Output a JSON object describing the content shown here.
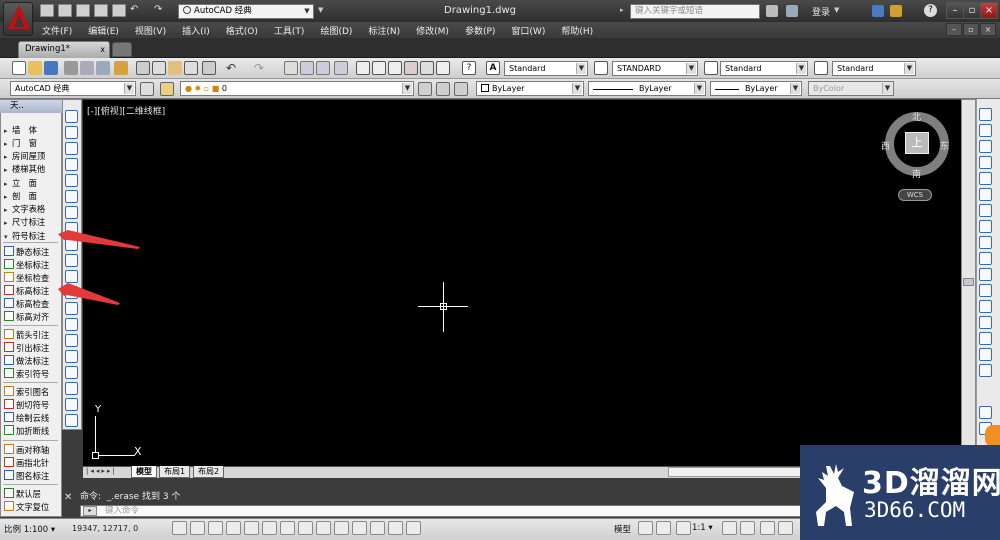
{
  "titlebar": {
    "workspace": "AutoCAD 经典",
    "document": "Drawing1.dwg",
    "search_placeholder": "键入关键字或短语",
    "login": "登录",
    "help": "?"
  },
  "menu": [
    "文件(F)",
    "编辑(E)",
    "视图(V)",
    "插入(I)",
    "格式(O)",
    "工具(T)",
    "绘图(D)",
    "标注(N)",
    "修改(M)",
    "参数(P)",
    "窗口(W)",
    "帮助(H)"
  ],
  "doc_tab": {
    "label": "Drawing1*",
    "close": "x"
  },
  "toolbar1": {
    "text_style": "Standard",
    "dim_style": "STANDARD",
    "table_style": "Standard",
    "mleader_style": "Standard"
  },
  "toolbar2": {
    "workspace": "AutoCAD 经典",
    "layer": "0",
    "color": "ByLayer",
    "linetype": "ByLayer",
    "lineweight": "ByLayer",
    "plotstyle": "ByColor"
  },
  "palette": {
    "title": "天..",
    "items": [
      {
        "label": "墙　体",
        "arrow": "▸"
      },
      {
        "label": "门　窗",
        "arrow": "▸"
      },
      {
        "label": "房间屋顶",
        "arrow": "▸"
      },
      {
        "label": "楼梯其他",
        "arrow": "▸"
      },
      {
        "label": "立　面",
        "arrow": "▸"
      },
      {
        "label": "剖　面",
        "arrow": "▸"
      },
      {
        "label": "文字表格",
        "arrow": "▸"
      },
      {
        "label": "尺寸标注",
        "arrow": "▸"
      },
      {
        "label": "符号标注",
        "arrow": "▾"
      },
      {
        "label": "静态标注"
      },
      {
        "label": "坐标标注"
      },
      {
        "label": "坐标检查"
      },
      {
        "label": "标高标注"
      },
      {
        "label": "标高检查"
      },
      {
        "label": "标高对齐"
      },
      {
        "label": "箭头引注"
      },
      {
        "label": "引出标注"
      },
      {
        "label": "做法标注"
      },
      {
        "label": "索引符号"
      },
      {
        "label": "索引图名"
      },
      {
        "label": "剖切符号"
      },
      {
        "label": "绘制云线"
      },
      {
        "label": "加折断线"
      },
      {
        "label": "画对称轴"
      },
      {
        "label": "画指北针"
      },
      {
        "label": "图名标注"
      },
      {
        "label": "默认层"
      },
      {
        "label": "文字复位"
      }
    ]
  },
  "canvas": {
    "view_label": "[-][俯视][二维线框]",
    "ucs_x": "X",
    "ucs_y": "Y"
  },
  "viewcube": {
    "top": "上",
    "north": "北",
    "south": "南",
    "east": "东",
    "west": "西",
    "wcs": "WCS"
  },
  "layout_tabs": [
    "模型",
    "布局1",
    "布局2"
  ],
  "command": {
    "history": "命令:  _.erase 找到 3 个",
    "placeholder": "键入命令"
  },
  "status": {
    "scale": "比例 1:100 ▾",
    "coords": "19347, 12717, 0",
    "model": "模型",
    "annotation_scale": "1:1 ▾"
  },
  "watermark": {
    "line1": "3D溜溜网",
    "line2": "3D66.COM"
  },
  "colors": {
    "canvas": "#000000",
    "accent_red": "#c01010",
    "annotation_arrow": "#e23a3a"
  }
}
